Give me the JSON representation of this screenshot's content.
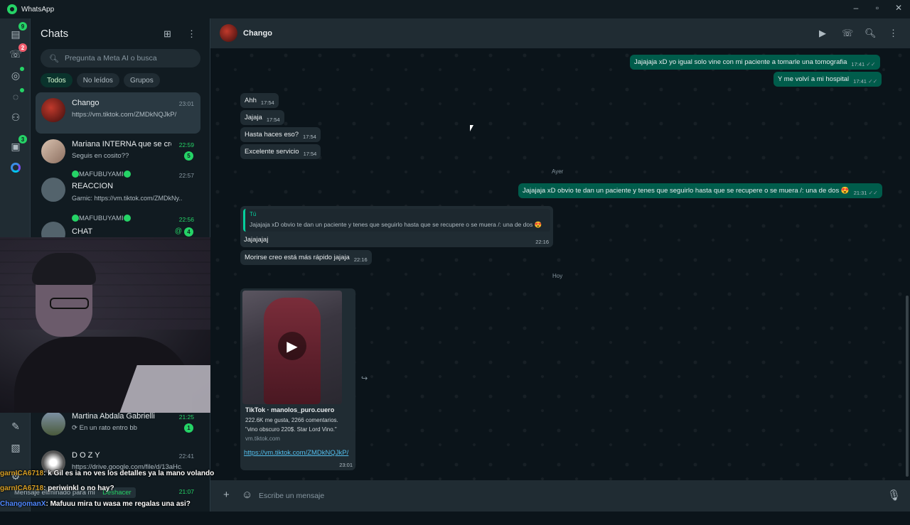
{
  "window": {
    "title": "WhatsApp"
  },
  "rail": {
    "chats_badge": "9",
    "calls_badge": "2",
    "archive_badge": "3",
    "accent": "#25d366"
  },
  "chatlist": {
    "title": "Chats",
    "search_placeholder": "Pregunta a Meta AI o busca",
    "filters": [
      "Todos",
      "No leídos",
      "Grupos"
    ],
    "items": [
      {
        "name": "Chango",
        "time": "23:01",
        "preview": "https://vm.tiktok.com/ZMDkNQJkP/"
      },
      {
        "name": "Mariana INTERNA que se cre...",
        "time": "22:59",
        "preview": "Seguis en cosito??",
        "badge": "5"
      },
      {
        "name": "MAFUBUYAMI",
        "subtitle": "REACCION",
        "time": "22:57",
        "preview": "Garnic: https://vm.tiktok.com/ZMDkNy..."
      },
      {
        "name": "MAFUBUYAMI",
        "subtitle": "CHAT",
        "time": "22:56",
        "badge": "4",
        "mention": "@"
      },
      {
        "name": "Martina Abdala Gabrielli",
        "time": "21:25",
        "preview": "En un rato entro bb",
        "badge": "1"
      },
      {
        "name": "D O Z Y",
        "time": "22:41",
        "preview": "https://drive.google.com/file/d/13aHc..."
      },
      {
        "time": "21:07"
      }
    ]
  },
  "stream_chat": [
    {
      "user": "garnICA6718",
      "text": "k Gil es ia no ves los detalles ya la mano volando"
    },
    {
      "user": "garnICA6718",
      "text": "periwinkl o no hay?"
    },
    {
      "user": "ChangomanX",
      "text": "Mafuuu mira tu wasa me regalas una asi?"
    }
  ],
  "toast": {
    "text": "Mensaje eliminado para mí",
    "action": "Deshacer"
  },
  "conversation": {
    "contact": "Chango",
    "messages": [
      {
        "dir": "out",
        "text": "Jajajaja xD yo igual solo vine con mi paciente a tomarle una tomografia",
        "time": "17:41"
      },
      {
        "dir": "out",
        "text": "Y me volví a mi hospital",
        "time": "17:41"
      },
      {
        "dir": "in",
        "text": "Ahh",
        "time": "17:54"
      },
      {
        "dir": "in",
        "text": "Jajaja",
        "time": "17:54"
      },
      {
        "dir": "in",
        "text": "Hasta haces eso?",
        "time": "17:54"
      },
      {
        "dir": "in",
        "text": "Excelente servicio",
        "time": "17:54"
      },
      {
        "dir": "sep",
        "text": "Ayer"
      },
      {
        "dir": "out",
        "text": "Jajajaja xD obvio te dan un paciente y tenes que seguirlo hasta que se recupere o se muera /: una de dos 😍",
        "time": "21:31"
      },
      {
        "dir": "in",
        "quote_author": "Tú",
        "quote_text": "Jajajaja xD obvio te dan un paciente y tenes que seguirlo hasta que se recupere o se muera /: una de dos 😍",
        "text": "Jajajajaj",
        "time": "22:16"
      },
      {
        "dir": "in",
        "text": "Morirse creo está más rápido jajaja",
        "time": "22:16"
      },
      {
        "dir": "sep",
        "text": "Hoy"
      }
    ],
    "link_preview": {
      "title": "TikTok · manolos_puro.cuero",
      "description": "222.6K me gusta, 2266 comentarios. \"vino obscuro 220$. Star Lord Vino.\"",
      "domain": "vm.tiktok.com",
      "url": "https://vm.tiktok.com/ZMDkNQJkP/",
      "time": "23:01"
    },
    "composer_placeholder": "Escribe un mensaje"
  }
}
